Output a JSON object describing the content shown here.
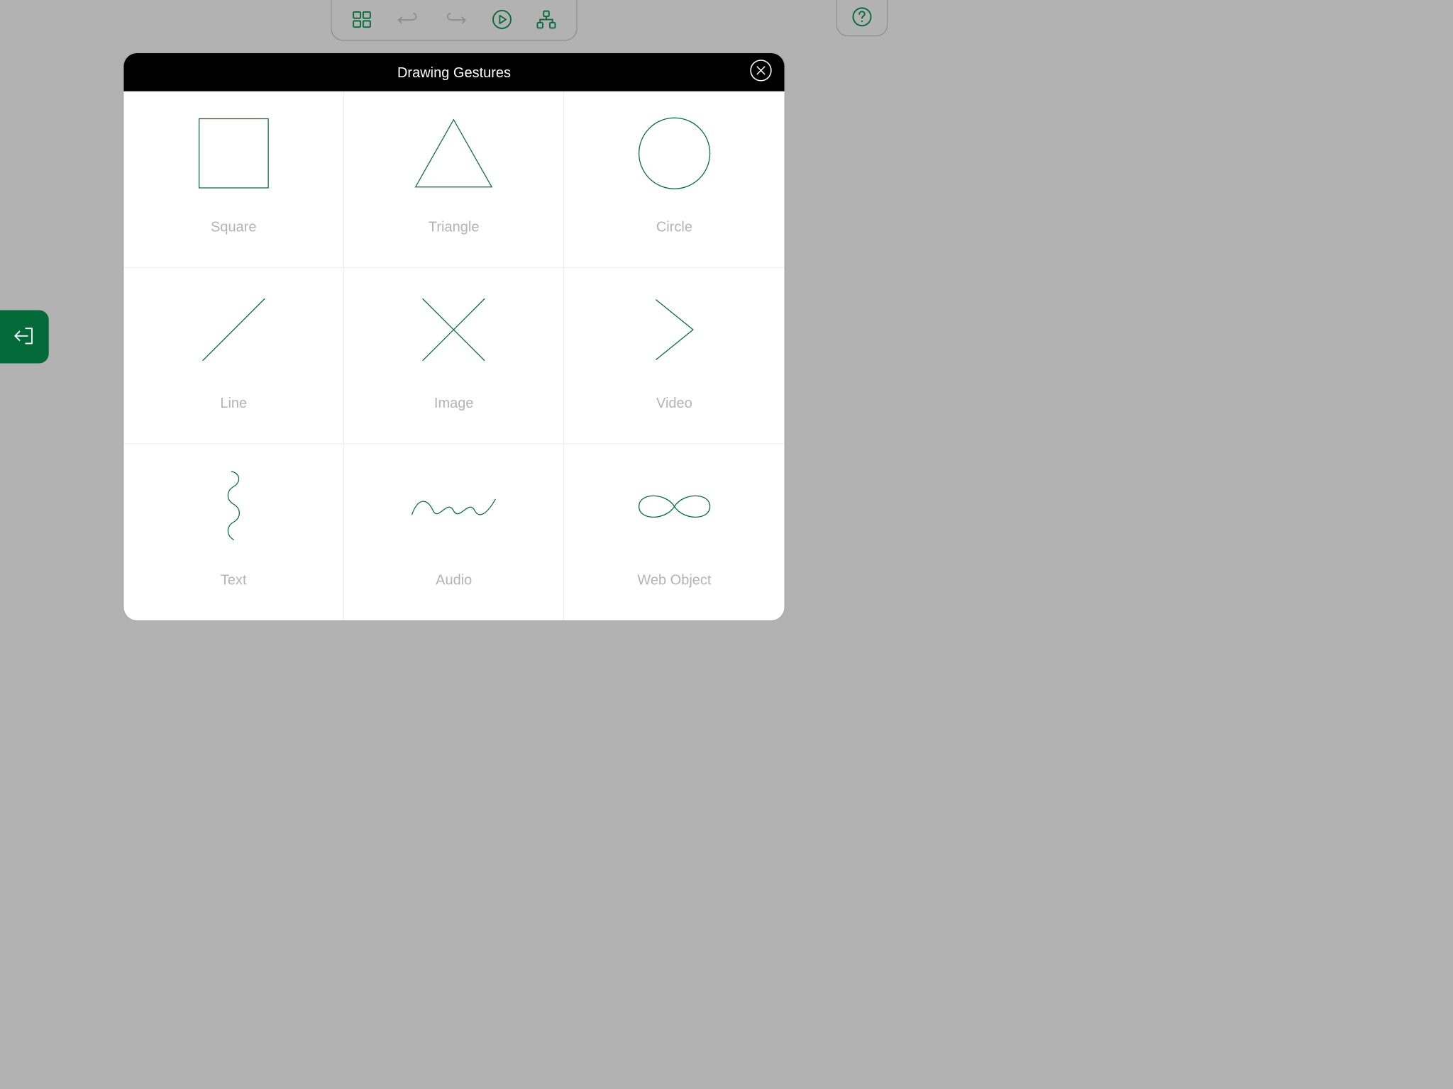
{
  "colors": {
    "accent": "#046a3a"
  },
  "toolbar": {
    "icons": [
      "grid-icon",
      "undo-icon",
      "redo-icon",
      "play-icon",
      "hierarchy-icon"
    ]
  },
  "help": {
    "icon": "help-icon"
  },
  "side": {
    "icon": "exit-icon"
  },
  "modal": {
    "title": "Drawing Gestures",
    "close_icon": "close-icon",
    "gestures": [
      {
        "label": "Square",
        "icon": "square-icon"
      },
      {
        "label": "Triangle",
        "icon": "triangle-icon"
      },
      {
        "label": "Circle",
        "icon": "circle-icon"
      },
      {
        "label": "Line",
        "icon": "line-icon"
      },
      {
        "label": "Image",
        "icon": "x-icon"
      },
      {
        "label": "Video",
        "icon": "chevron-right-icon"
      },
      {
        "label": "Text",
        "icon": "squiggle-vertical-icon"
      },
      {
        "label": "Audio",
        "icon": "wave-icon"
      },
      {
        "label": "Web Object",
        "icon": "infinity-icon"
      }
    ]
  }
}
